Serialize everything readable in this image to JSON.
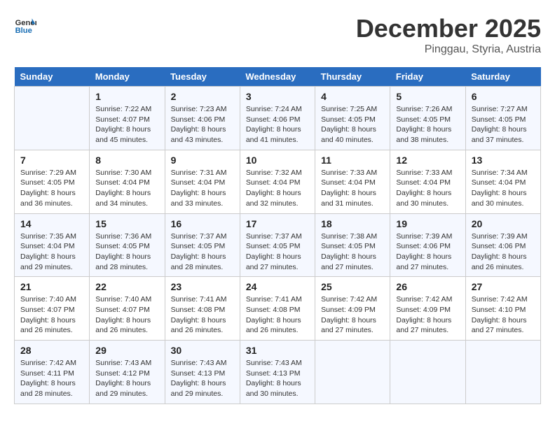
{
  "header": {
    "logo_line1": "General",
    "logo_line2": "Blue",
    "month": "December 2025",
    "location": "Pinggau, Styria, Austria"
  },
  "weekdays": [
    "Sunday",
    "Monday",
    "Tuesday",
    "Wednesday",
    "Thursday",
    "Friday",
    "Saturday"
  ],
  "weeks": [
    [
      {
        "day": "",
        "info": ""
      },
      {
        "day": "1",
        "info": "Sunrise: 7:22 AM\nSunset: 4:07 PM\nDaylight: 8 hours\nand 45 minutes."
      },
      {
        "day": "2",
        "info": "Sunrise: 7:23 AM\nSunset: 4:06 PM\nDaylight: 8 hours\nand 43 minutes."
      },
      {
        "day": "3",
        "info": "Sunrise: 7:24 AM\nSunset: 4:06 PM\nDaylight: 8 hours\nand 41 minutes."
      },
      {
        "day": "4",
        "info": "Sunrise: 7:25 AM\nSunset: 4:05 PM\nDaylight: 8 hours\nand 40 minutes."
      },
      {
        "day": "5",
        "info": "Sunrise: 7:26 AM\nSunset: 4:05 PM\nDaylight: 8 hours\nand 38 minutes."
      },
      {
        "day": "6",
        "info": "Sunrise: 7:27 AM\nSunset: 4:05 PM\nDaylight: 8 hours\nand 37 minutes."
      }
    ],
    [
      {
        "day": "7",
        "info": "Sunrise: 7:29 AM\nSunset: 4:05 PM\nDaylight: 8 hours\nand 36 minutes."
      },
      {
        "day": "8",
        "info": "Sunrise: 7:30 AM\nSunset: 4:04 PM\nDaylight: 8 hours\nand 34 minutes."
      },
      {
        "day": "9",
        "info": "Sunrise: 7:31 AM\nSunset: 4:04 PM\nDaylight: 8 hours\nand 33 minutes."
      },
      {
        "day": "10",
        "info": "Sunrise: 7:32 AM\nSunset: 4:04 PM\nDaylight: 8 hours\nand 32 minutes."
      },
      {
        "day": "11",
        "info": "Sunrise: 7:33 AM\nSunset: 4:04 PM\nDaylight: 8 hours\nand 31 minutes."
      },
      {
        "day": "12",
        "info": "Sunrise: 7:33 AM\nSunset: 4:04 PM\nDaylight: 8 hours\nand 30 minutes."
      },
      {
        "day": "13",
        "info": "Sunrise: 7:34 AM\nSunset: 4:04 PM\nDaylight: 8 hours\nand 30 minutes."
      }
    ],
    [
      {
        "day": "14",
        "info": "Sunrise: 7:35 AM\nSunset: 4:04 PM\nDaylight: 8 hours\nand 29 minutes."
      },
      {
        "day": "15",
        "info": "Sunrise: 7:36 AM\nSunset: 4:05 PM\nDaylight: 8 hours\nand 28 minutes."
      },
      {
        "day": "16",
        "info": "Sunrise: 7:37 AM\nSunset: 4:05 PM\nDaylight: 8 hours\nand 28 minutes."
      },
      {
        "day": "17",
        "info": "Sunrise: 7:37 AM\nSunset: 4:05 PM\nDaylight: 8 hours\nand 27 minutes."
      },
      {
        "day": "18",
        "info": "Sunrise: 7:38 AM\nSunset: 4:05 PM\nDaylight: 8 hours\nand 27 minutes."
      },
      {
        "day": "19",
        "info": "Sunrise: 7:39 AM\nSunset: 4:06 PM\nDaylight: 8 hours\nand 27 minutes."
      },
      {
        "day": "20",
        "info": "Sunrise: 7:39 AM\nSunset: 4:06 PM\nDaylight: 8 hours\nand 26 minutes."
      }
    ],
    [
      {
        "day": "21",
        "info": "Sunrise: 7:40 AM\nSunset: 4:07 PM\nDaylight: 8 hours\nand 26 minutes."
      },
      {
        "day": "22",
        "info": "Sunrise: 7:40 AM\nSunset: 4:07 PM\nDaylight: 8 hours\nand 26 minutes."
      },
      {
        "day": "23",
        "info": "Sunrise: 7:41 AM\nSunset: 4:08 PM\nDaylight: 8 hours\nand 26 minutes."
      },
      {
        "day": "24",
        "info": "Sunrise: 7:41 AM\nSunset: 4:08 PM\nDaylight: 8 hours\nand 26 minutes."
      },
      {
        "day": "25",
        "info": "Sunrise: 7:42 AM\nSunset: 4:09 PM\nDaylight: 8 hours\nand 27 minutes."
      },
      {
        "day": "26",
        "info": "Sunrise: 7:42 AM\nSunset: 4:09 PM\nDaylight: 8 hours\nand 27 minutes."
      },
      {
        "day": "27",
        "info": "Sunrise: 7:42 AM\nSunset: 4:10 PM\nDaylight: 8 hours\nand 27 minutes."
      }
    ],
    [
      {
        "day": "28",
        "info": "Sunrise: 7:42 AM\nSunset: 4:11 PM\nDaylight: 8 hours\nand 28 minutes."
      },
      {
        "day": "29",
        "info": "Sunrise: 7:43 AM\nSunset: 4:12 PM\nDaylight: 8 hours\nand 29 minutes."
      },
      {
        "day": "30",
        "info": "Sunrise: 7:43 AM\nSunset: 4:13 PM\nDaylight: 8 hours\nand 29 minutes."
      },
      {
        "day": "31",
        "info": "Sunrise: 7:43 AM\nSunset: 4:13 PM\nDaylight: 8 hours\nand 30 minutes."
      },
      {
        "day": "",
        "info": ""
      },
      {
        "day": "",
        "info": ""
      },
      {
        "day": "",
        "info": ""
      }
    ]
  ]
}
